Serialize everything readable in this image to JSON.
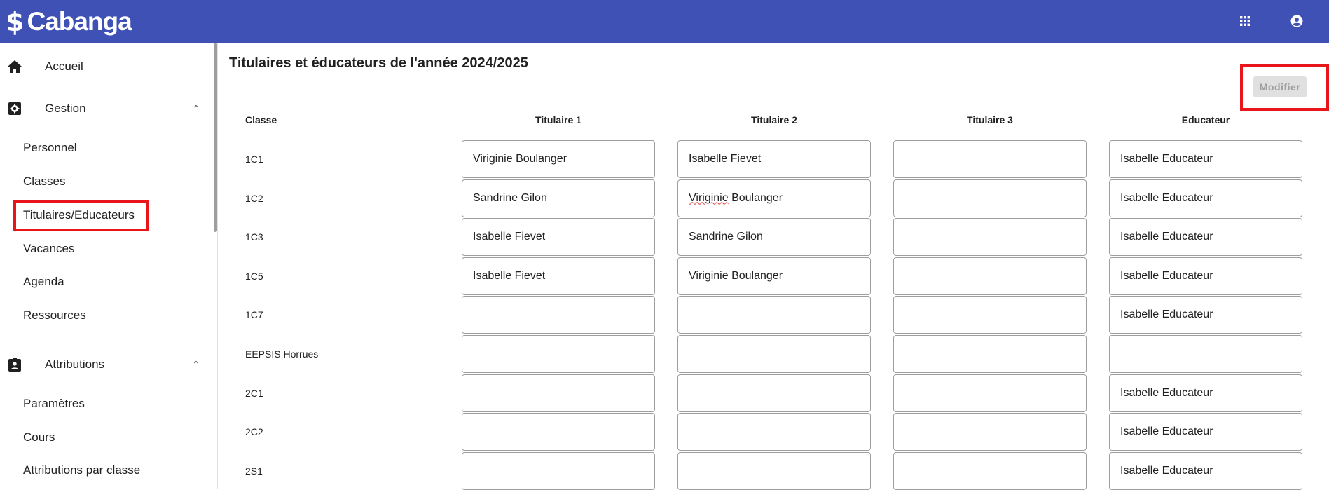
{
  "app": {
    "name": "Cabanga",
    "logo_symbol": "$",
    "brand_color": "#3f51b5"
  },
  "header": {
    "apps_icon": "apps-grid-icon",
    "account_icon": "account-circle-icon"
  },
  "sidebar": {
    "home": {
      "label": "Accueil",
      "icon": "home-icon"
    },
    "gestion": {
      "label": "Gestion",
      "icon": "settings-box-icon",
      "expanded": true,
      "items": [
        "Personnel",
        "Classes",
        "Titulaires/Educateurs",
        "Vacances",
        "Agenda",
        "Ressources"
      ],
      "active": "Titulaires/Educateurs"
    },
    "attributions": {
      "label": "Attributions",
      "icon": "clipboard-account-icon",
      "expanded": true,
      "items": [
        "Paramètres",
        "Cours",
        "Attributions par classe"
      ]
    }
  },
  "main": {
    "title": "Titulaires et éducateurs de l'année 2024/2025",
    "modify_label": "Modifier",
    "columns": {
      "classe": "Classe",
      "t1": "Titulaire 1",
      "t2": "Titulaire 2",
      "t3": "Titulaire 3",
      "edu": "Educateur"
    },
    "rows": [
      {
        "classe": "1C1",
        "t1": "Viriginie Boulanger",
        "t2": "Isabelle Fievet",
        "t3": "",
        "edu": "Isabelle Educateur"
      },
      {
        "classe": "1C2",
        "t1": "Sandrine Gilon",
        "t2": "Viriginie Boulanger",
        "t3": "",
        "edu": "Isabelle Educateur"
      },
      {
        "classe": "1C3",
        "t1": "Isabelle Fievet",
        "t2": "Sandrine Gilon",
        "t3": "",
        "edu": "Isabelle Educateur"
      },
      {
        "classe": "1C5",
        "t1": "Isabelle Fievet",
        "t2": "Viriginie Boulanger",
        "t3": "",
        "edu": "Isabelle Educateur"
      },
      {
        "classe": "1C7",
        "t1": "",
        "t2": "",
        "t3": "",
        "edu": "Isabelle Educateur"
      },
      {
        "classe": "EEPSIS Horrues",
        "t1": "",
        "t2": "",
        "t3": "",
        "edu": ""
      },
      {
        "classe": "2C1",
        "t1": "",
        "t2": "",
        "t3": "",
        "edu": "Isabelle Educateur"
      },
      {
        "classe": "2C2",
        "t1": "",
        "t2": "",
        "t3": "",
        "edu": "Isabelle Educateur"
      },
      {
        "classe": "2S1",
        "t1": "",
        "t2": "",
        "t3": "",
        "edu": "Isabelle Educateur"
      }
    ]
  }
}
